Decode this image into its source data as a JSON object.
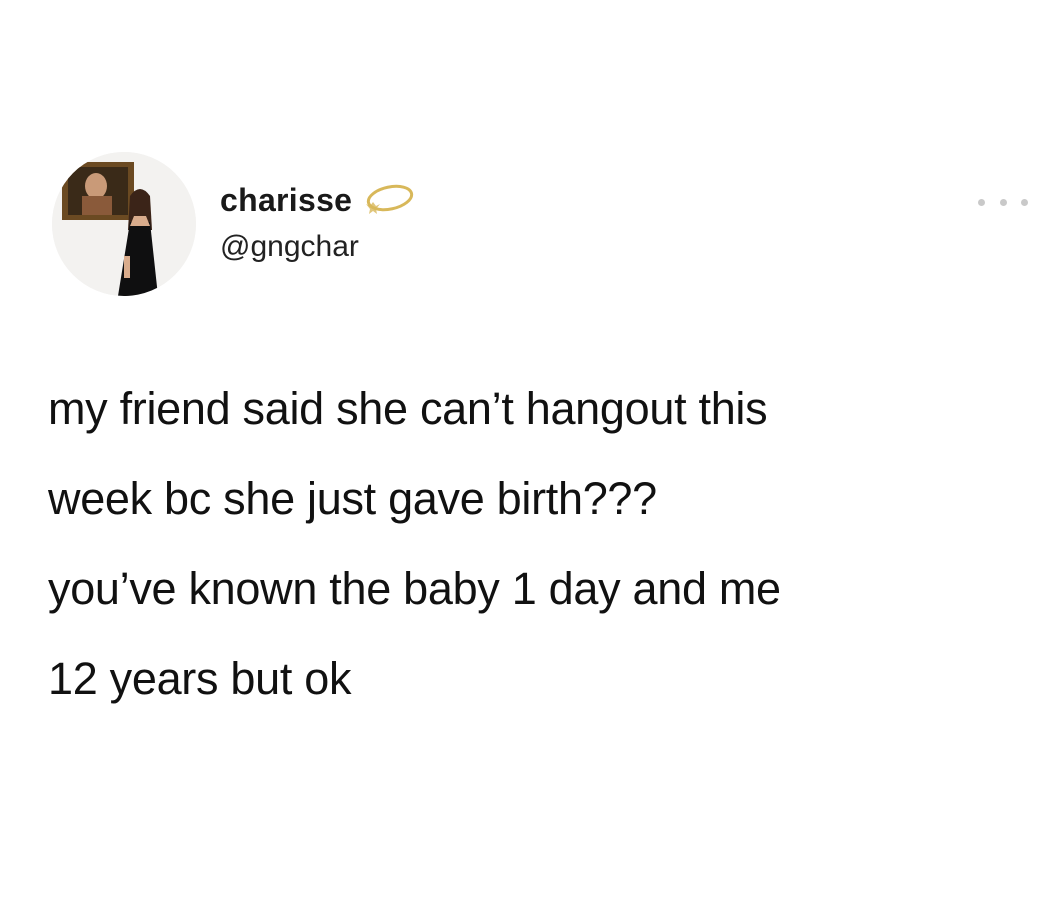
{
  "user": {
    "display_name": "charisse",
    "handle": "@gngchar",
    "avatar": "profile-photo",
    "badge_icon": "halo-icon"
  },
  "menu": {
    "icon": "more-options-icon"
  },
  "tweet": {
    "lines": [
      "my friend said she can’t hangout this",
      "week bc she just gave birth???",
      "you’ve known the baby 1 day and me",
      "12 years but ok"
    ]
  },
  "colors": {
    "background": "#ffffff",
    "text": "#111111",
    "halo": "#d8b85a",
    "more_dots": "#c9c9c9"
  }
}
